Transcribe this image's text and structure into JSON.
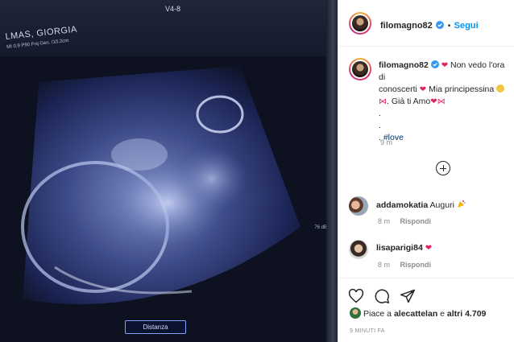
{
  "photo": {
    "patient_name": "LMAS, GIORGIA",
    "scan_params": "MI 0.9 P90 Frq Gen. /10.2cm",
    "probe": "V4-8",
    "right_readout": "76 dB",
    "distance_button": "Distanza"
  },
  "header": {
    "username": "filomagno82",
    "separator": "•",
    "follow_label": "Segui"
  },
  "caption": {
    "username": "filomagno82",
    "text_1": "Non vedo l'ora di",
    "text_2": "conoscerti",
    "text_3": "Mia principessina",
    "text_4": ". Già ti Amo",
    "dot_1": ".",
    "dot_2": ".",
    "hashtag_prefix": ". ",
    "hashtag": "#love",
    "time": "9 m"
  },
  "comments": [
    {
      "username": "addamokatia",
      "text": "Auguri",
      "time": "8 m",
      "reply": "Rispondi"
    },
    {
      "username": "lisaparigi84",
      "text": "",
      "time": "8 m",
      "reply": "Rispondi"
    }
  ],
  "likes": {
    "prefix": "Piace a ",
    "user": "alecattelan",
    "suffix": " e ",
    "others": "altri 4.709"
  },
  "post_time": "9 MINUTI FA",
  "colors": {
    "accent_blue": "#0095f6",
    "heart_red": "#e0245e",
    "hashtag_blue": "#00376b",
    "muted_gray": "#8e8e8e"
  }
}
